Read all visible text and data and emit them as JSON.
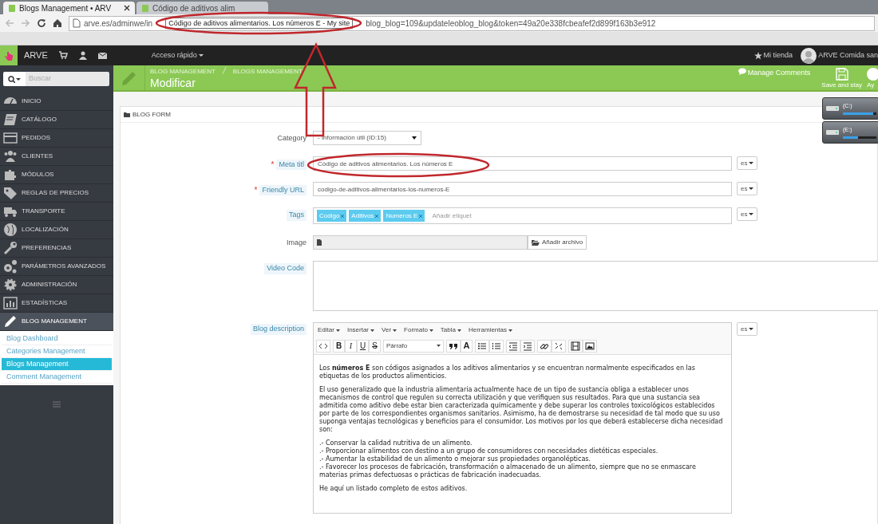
{
  "browser": {
    "tabs": [
      {
        "label": "Blogs Management • ARV",
        "selected": true
      },
      {
        "label": "Código de aditivos alim",
        "selected": false
      }
    ],
    "url_start": "arve.es/adminwe/in",
    "url_tooltip": "Código de aditivos alimentarios. Los números E - My site",
    "url_end": "blog_blog=109&updateleoblog_blog&token=49a20e338fcbeafef2d899f163b3e912"
  },
  "topbar": {
    "shop": "ARVE",
    "quick_access": "Acceso rápido",
    "store_link": "Mi tienda",
    "user": "ARVE Comida san"
  },
  "sidebar": {
    "search_placeholder": "Buscar",
    "items": [
      {
        "label": "INICIO",
        "selected": false
      },
      {
        "label": "CATÁLOGO",
        "selected": false
      },
      {
        "label": "PEDIDOS",
        "selected": false
      },
      {
        "label": "CLIENTES",
        "selected": false
      },
      {
        "label": "MÓDULOS",
        "selected": false
      },
      {
        "label": "REGLAS DE PRECIOS",
        "selected": false
      },
      {
        "label": "TRANSPORTE",
        "selected": false
      },
      {
        "label": "LOCALIZACIÓN",
        "selected": false
      },
      {
        "label": "PREFERENCIAS",
        "selected": false
      },
      {
        "label": "PARÁMETROS AVANZADOS",
        "selected": false
      },
      {
        "label": "ADMINISTRACIÓN",
        "selected": false
      },
      {
        "label": "ESTADÍSTICAS",
        "selected": false
      },
      {
        "label": "BLOG MANAGEMENT",
        "selected": true
      }
    ],
    "submenu": [
      {
        "label": "Blog Dashboard",
        "selected": false
      },
      {
        "label": "Categories Management",
        "selected": false
      },
      {
        "label": "Blogs Management",
        "selected": true
      },
      {
        "label": "Comment Management",
        "selected": false
      }
    ]
  },
  "header": {
    "breadcrumb": [
      "BLOG MANAGEMENT",
      "BLOGS MANAGEMENT"
    ],
    "title": "Modificar",
    "manage_comments": "Manage Comments",
    "save_and_stay": "Save and stay",
    "help": "Ay"
  },
  "drives": [
    {
      "label": "(C:)",
      "level": 0.9
    },
    {
      "label": "(E:)",
      "level": 0.45
    }
  ],
  "form": {
    "title": "BLOG FORM",
    "fields": [
      {
        "kind": "select",
        "label": "Category",
        "hint": false,
        "value": "- Información útil (ID:15)"
      },
      {
        "kind": "text",
        "label": "Meta titl",
        "required_mark": "*",
        "hint": true,
        "value": "Código de aditivos alimentarios. Los números E",
        "lang": "es"
      },
      {
        "kind": "text",
        "label": "Friendly URL",
        "required_mark": "*",
        "hint": true,
        "value": "codigo-de-aditivos-alimentarios-los-numeros-E",
        "lang": "es"
      },
      {
        "kind": "tags",
        "label": "Tags",
        "hint": true,
        "tags": [
          "Codigo",
          "Aditivos",
          "Numeros E"
        ],
        "placeholder": "Añadir etiquet",
        "lang": "es"
      },
      {
        "kind": "file",
        "label": "Image",
        "hint": false,
        "button": "Añadir archivo"
      },
      {
        "kind": "textarea",
        "label": "Video Code",
        "hint": true
      },
      {
        "kind": "editor",
        "label": "Blog description",
        "hint": true,
        "lang": "es"
      }
    ]
  },
  "editor": {
    "menus": [
      "Editar",
      "Insertar",
      "Ver",
      "Formato",
      "Tabla",
      "Herramientas"
    ],
    "format": "Párrafo",
    "toolbar": [
      [
        {
          "kind": "code"
        }
      ],
      [
        {
          "kind": "bold",
          "label": "B"
        },
        {
          "kind": "italic",
          "label": "I"
        },
        {
          "kind": "underline",
          "label": "U"
        },
        {
          "kind": "strike",
          "label": "S"
        }
      ],
      [
        {
          "kind": "format"
        }
      ],
      [
        {
          "kind": "quote"
        },
        {
          "kind": "color",
          "label": "A"
        }
      ],
      [
        {
          "kind": "bullets"
        },
        {
          "kind": "numbers"
        }
      ],
      [
        {
          "kind": "outdent"
        },
        {
          "kind": "indent"
        }
      ],
      [
        {
          "kind": "link"
        },
        {
          "kind": "unlink"
        }
      ],
      [
        {
          "kind": "video"
        },
        {
          "kind": "image"
        }
      ]
    ],
    "paragraphs": [
      "Los **números E** son códigos asignados a los aditivos alimentarios y se encuentran normalmente especificados en las etiquetas de los productos alimenticios.",
      "El uso generalizado que la industria alimentaria actualmente hace de un tipo de sustancia obliga a establecer unos mecanismos de control que regulen su correcta utilización y que verifiquen sus resultados. Para que una sustancia sea admitida como aditivo debe estar bien caracterizada químicamente y debe superar los controles toxicológicos establecidos por parte de los correspondientes organismos sanitarios. Asimismo, ha de demostrarse su necesidad de tal modo que su uso suponga ventajas tecnológicas y beneficios para el consumidor. Los motivos por los que deberá establecerse dicha necesidad son:",
      ".- Conservar la calidad nutritiva de un alimento.\n.- Proporcionar alimentos con destino a un grupo de consumidores con necesidades dietéticas especiales.\n.- Aumentar la estabilidad de un alimento o mejorar sus propiedades organolépticas.\n.- Favorecer los procesos de fabricación, transformación o almacenado de un alimento, siempre que no se enmascare materias primas defectuosas o prácticas de fabricación inadecuadas.",
      "He aquí un listado completo de estos aditivos."
    ]
  }
}
